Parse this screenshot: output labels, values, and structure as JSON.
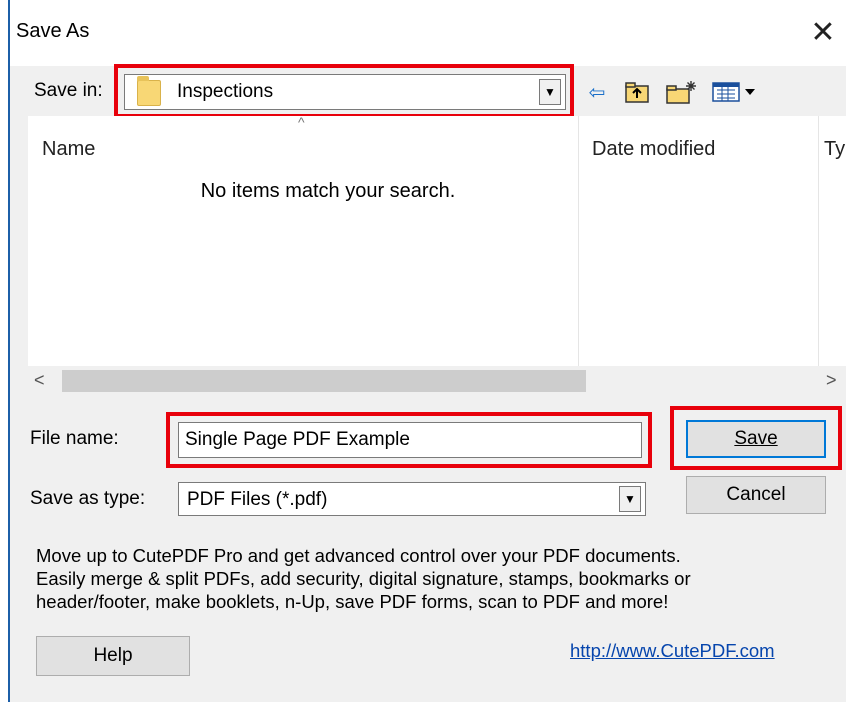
{
  "dialog": {
    "title": "Save As"
  },
  "save_in": {
    "label": "Save in:",
    "value": "Inspections"
  },
  "toolbar": {
    "back_icon": "back-arrow-icon",
    "up_icon": "up-folder-icon",
    "new_folder_icon": "new-folder-icon",
    "view_icon": "view-menu-icon"
  },
  "file_list": {
    "columns": [
      "Name",
      "Date modified",
      "Ty"
    ],
    "empty_message": "No items match your search."
  },
  "file_name": {
    "label": "File name:",
    "value": "Single Page PDF Example"
  },
  "save_as_type": {
    "label": "Save as type:",
    "value": "PDF Files (*.pdf)"
  },
  "buttons": {
    "save": "Save",
    "cancel": "Cancel",
    "help": "Help"
  },
  "promo": {
    "line1": "Move up to CutePDF Pro and get advanced control over your PDF documents.",
    "line2": "Easily merge & split PDFs, add security, digital signature, stamps, bookmarks or",
    "line3": "header/footer, make booklets, n-Up, save PDF forms, scan to PDF and more!"
  },
  "link": {
    "text": "http://www.CutePDF.com"
  },
  "colors": {
    "highlight": "#e8000b",
    "window_border": "#1c5fa8",
    "link": "#0645ad"
  }
}
